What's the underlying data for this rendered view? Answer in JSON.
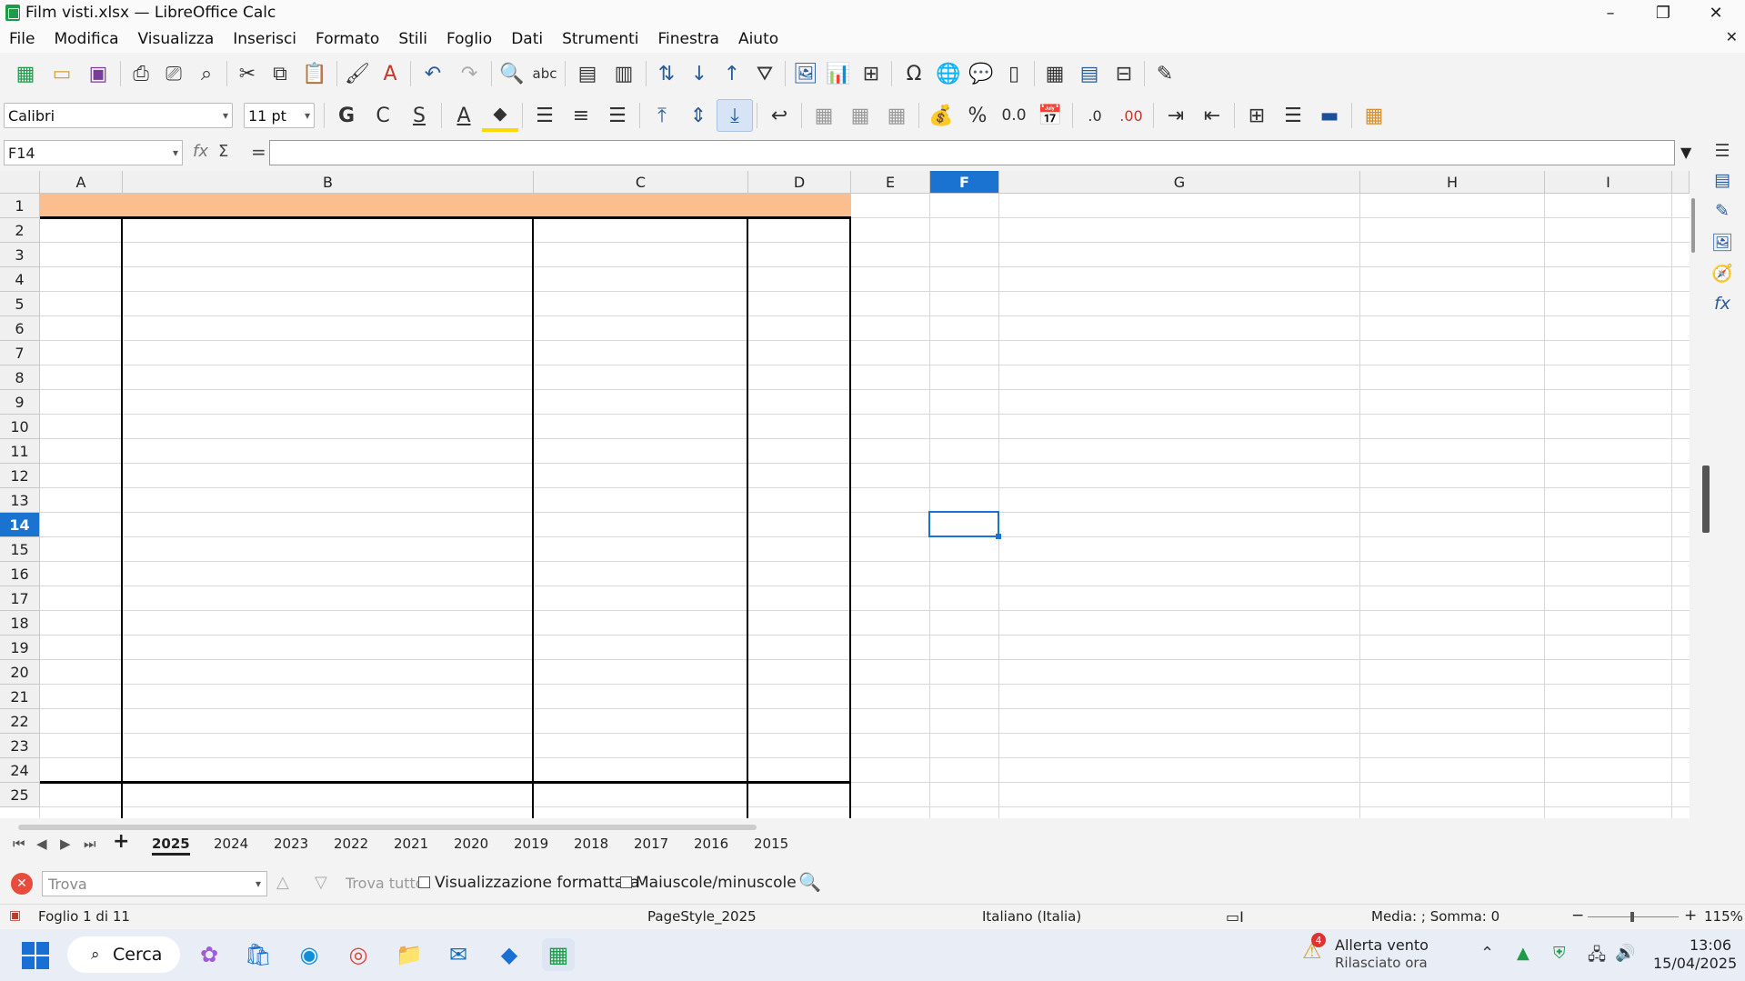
{
  "window": {
    "title": "Film visti.xlsx — LibreOffice Calc",
    "minimize": "–",
    "restore": "❐",
    "close": "✕",
    "doc_close": "✕"
  },
  "menu": [
    "File",
    "Modifica",
    "Visualizza",
    "Inserisci",
    "Formato",
    "Stili",
    "Foglio",
    "Dati",
    "Strumenti",
    "Finestra",
    "Aiuto"
  ],
  "format": {
    "font_name": "Calibri",
    "font_size": "11 pt",
    "bold": "G",
    "italic": "C",
    "underline": "S"
  },
  "formula": {
    "name_box": "F14",
    "fx": "fx",
    "sigma": "Σ",
    "equals": "=",
    "content": ""
  },
  "columns": [
    {
      "label": "A",
      "selected": false
    },
    {
      "label": "B",
      "selected": false
    },
    {
      "label": "C",
      "selected": false
    },
    {
      "label": "D",
      "selected": false
    },
    {
      "label": "E",
      "selected": false
    },
    {
      "label": "F",
      "selected": true
    },
    {
      "label": "G",
      "selected": false
    },
    {
      "label": "H",
      "selected": false
    },
    {
      "label": "I",
      "selected": false
    }
  ],
  "rows": [
    "1",
    "2",
    "3",
    "4",
    "5",
    "6",
    "7",
    "8",
    "9",
    "10",
    "11",
    "12",
    "13",
    "14",
    "15",
    "16",
    "17",
    "18",
    "19",
    "20",
    "21",
    "22",
    "23",
    "24",
    "25"
  ],
  "selected_row": "14",
  "header_fill_color": "#fbbf8f",
  "sheets": {
    "tabs": [
      "2025",
      "2024",
      "2023",
      "2022",
      "2021",
      "2020",
      "2019",
      "2018",
      "2017",
      "2016",
      "2015"
    ],
    "active": "2025",
    "add": "+"
  },
  "find": {
    "placeholder": "Trova",
    "find_all": "Trova tutto",
    "formatted_label": "Visualizzazione formattata",
    "case_label": "Maiuscole/minuscole"
  },
  "status": {
    "sheet": "Foglio 1 di 11",
    "page_style": "PageStyle_2025",
    "language": "Italiano (Italia)",
    "summary": "Media: ; Somma: 0",
    "zoom": "115%"
  },
  "taskbar": {
    "search": "Cerca",
    "weather_badge": "4",
    "weather_title": "Allerta vento",
    "weather_sub": "Rilasciato ora",
    "time": "13:06",
    "date": "15/04/2025"
  }
}
